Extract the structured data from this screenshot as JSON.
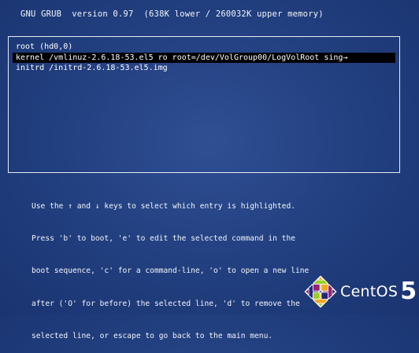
{
  "header": {
    "title": "GNU GRUB  version 0.97  (638K lower / 260032K upper memory)"
  },
  "menu": {
    "entries": [
      {
        "text": "root (hd0,0)"
      },
      {
        "text": "kernel /vmlinuz-2.6.18-53.el5 ro root=/dev/VolGroup00/LogVolRoot sing→"
      },
      {
        "text": "initrd /initrd-2.6.18-53.el5.img"
      }
    ],
    "selected_index": 1
  },
  "help": {
    "lines": [
      "Use the ↑ and ↓ keys to select which entry is highlighted.",
      "Press 'b' to boot, 'e' to edit the selected command in the",
      "boot sequence, 'c' for a command-line, 'o' to open a new line",
      "after ('O' for before) the selected line, 'd' to remove the",
      "selected line, or escape to go back to the main menu."
    ]
  },
  "logo": {
    "text": "CentOS",
    "version": "5",
    "icon": "centos-pinwheel-icon",
    "colors": {
      "green": "#9ccd2a",
      "purple": "#932279",
      "orange": "#efa724",
      "blue": "#262577"
    }
  },
  "colors": {
    "background": "#213e7e",
    "selection": "#000000",
    "text": "#ffffff"
  }
}
